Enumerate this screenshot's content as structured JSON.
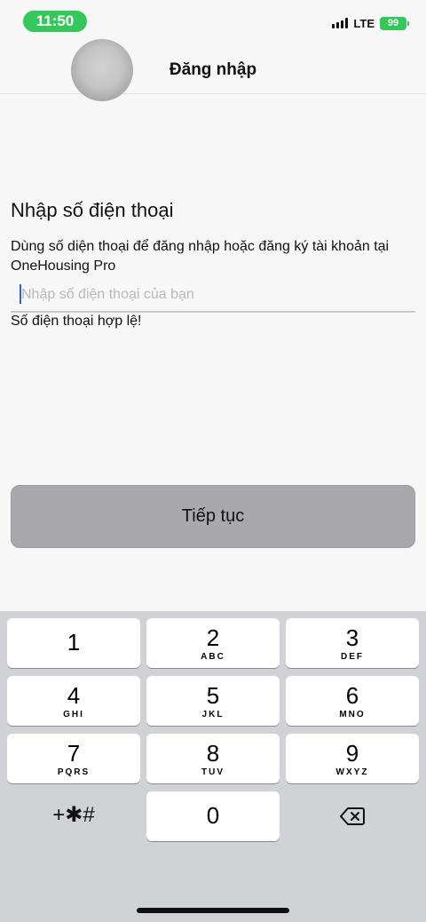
{
  "status": {
    "time": "11:50",
    "network": "LTE",
    "battery": "99"
  },
  "nav": {
    "title": "Đăng nhập"
  },
  "content": {
    "heading": "Nhập số điện thoại",
    "subtitle": "Dùng số diện thoại để đăng nhập hoặc đăng ký tài khoản tại OneHousing Pro",
    "phone_placeholder": "Nhập số điện thoại của bạn",
    "phone_value": "",
    "valid_message": "Số điện thoại hợp lệ!",
    "continue_label": "Tiếp tục"
  },
  "keypad": {
    "k1": {
      "digit": "1",
      "letters": ""
    },
    "k2": {
      "digit": "2",
      "letters": "ABC"
    },
    "k3": {
      "digit": "3",
      "letters": "DEF"
    },
    "k4": {
      "digit": "4",
      "letters": "GHI"
    },
    "k5": {
      "digit": "5",
      "letters": "JKL"
    },
    "k6": {
      "digit": "6",
      "letters": "MNO"
    },
    "k7": {
      "digit": "7",
      "letters": "PQRS"
    },
    "k8": {
      "digit": "8",
      "letters": "TUV"
    },
    "k9": {
      "digit": "9",
      "letters": "WXYZ"
    },
    "k0": {
      "digit": "0",
      "letters": ""
    },
    "symbols": "+✱#"
  },
  "icons": {
    "delete": "backspace-icon",
    "signal": "signal-icon",
    "battery": "battery-icon"
  },
  "colors": {
    "status_green": "#34c759",
    "button_gray": "#a9a9ad",
    "keyboard_bg": "#d1d2d6"
  }
}
